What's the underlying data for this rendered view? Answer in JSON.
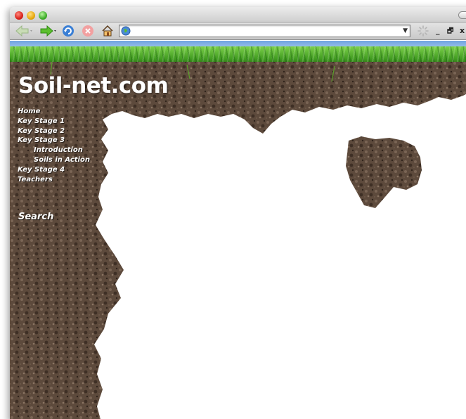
{
  "browser": {
    "address": "",
    "icons": {
      "back": "back-arrow-icon",
      "forward": "forward-arrow-icon",
      "reload": "reload-icon",
      "stop": "stop-icon",
      "home": "home-icon",
      "site": "globe-icon"
    },
    "window_controls": {
      "minimize": "_",
      "restore": "🗗",
      "close": "x"
    }
  },
  "site": {
    "title": "Soil-net.com",
    "nav": [
      {
        "label": "Home",
        "sub": false
      },
      {
        "label": "Key Stage 1",
        "sub": false
      },
      {
        "label": "Key Stage 2",
        "sub": false
      },
      {
        "label": "Key Stage 3",
        "sub": false
      },
      {
        "label": "Introduction",
        "sub": true
      },
      {
        "label": "Soils in Action",
        "sub": true
      },
      {
        "label": "Key Stage 4",
        "sub": false
      },
      {
        "label": "Teachers",
        "sub": false
      }
    ],
    "search_label": "Search"
  },
  "colors": {
    "soil": "#5a4638",
    "soil_dark": "#3b2c22",
    "grass": "#4fae2a",
    "sky": "#8ab8ea",
    "nav_text": "#ffffff"
  }
}
